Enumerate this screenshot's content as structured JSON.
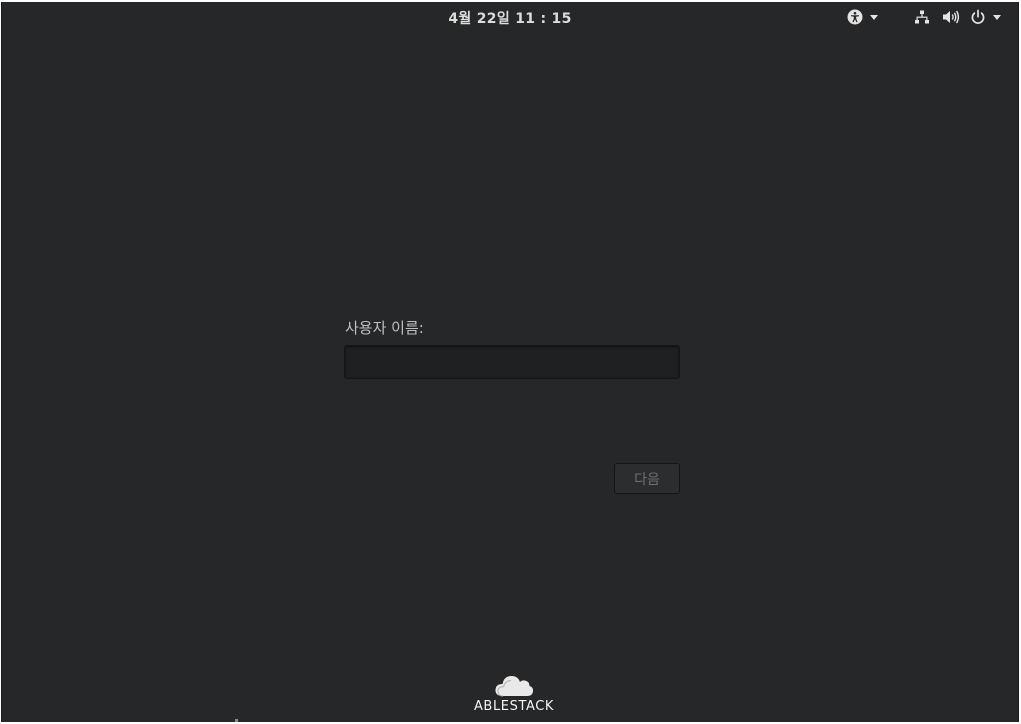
{
  "topbar": {
    "clock": "4월 22일  11 : 15",
    "indicators": {
      "accessibility_icon": "accessibility-icon",
      "network_icon": "network-wired-icon",
      "volume_icon": "volume-icon",
      "power_icon": "power-icon"
    }
  },
  "login": {
    "username_label": "사용자 이름:",
    "username_value": "",
    "next_label": "다음"
  },
  "brand": {
    "name": "ABLESTACK",
    "logo_icon": "cloud-logo-icon"
  },
  "colors": {
    "background": "#252728",
    "text": "#dcdcdc",
    "button_disabled_text": "#6e7070"
  }
}
